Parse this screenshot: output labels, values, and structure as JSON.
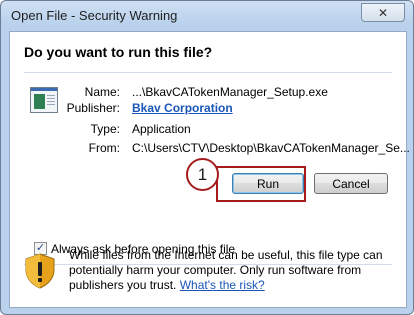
{
  "window": {
    "title": "Open File - Security Warning",
    "close_glyph": "✕"
  },
  "question": "Do you want to run this file?",
  "file_info": {
    "name_label": "Name:",
    "name_value": "...\\BkavCATokenManager_Setup.exe",
    "publisher_label": "Publisher:",
    "publisher_value": "Bkav Corporation",
    "type_label": "Type:",
    "type_value": "Application",
    "from_label": "From:",
    "from_value": "C:\\Users\\CTV\\Desktop\\BkavCATokenManager_Se..."
  },
  "buttons": {
    "run_label": "Run",
    "cancel_label": "Cancel"
  },
  "annotation": {
    "step_number": "1",
    "color": "#a51c1c"
  },
  "checkbox": {
    "label": "Always ask before opening this file",
    "checked": true,
    "check_glyph": "✓"
  },
  "warning": {
    "text": "While files from the Internet can be useful, this file type can potentially harm your computer. Only run software from publishers you trust.",
    "link_text": "What's the risk?"
  },
  "icons": {
    "file": "application-file-icon",
    "shield": "security-shield-icon"
  }
}
